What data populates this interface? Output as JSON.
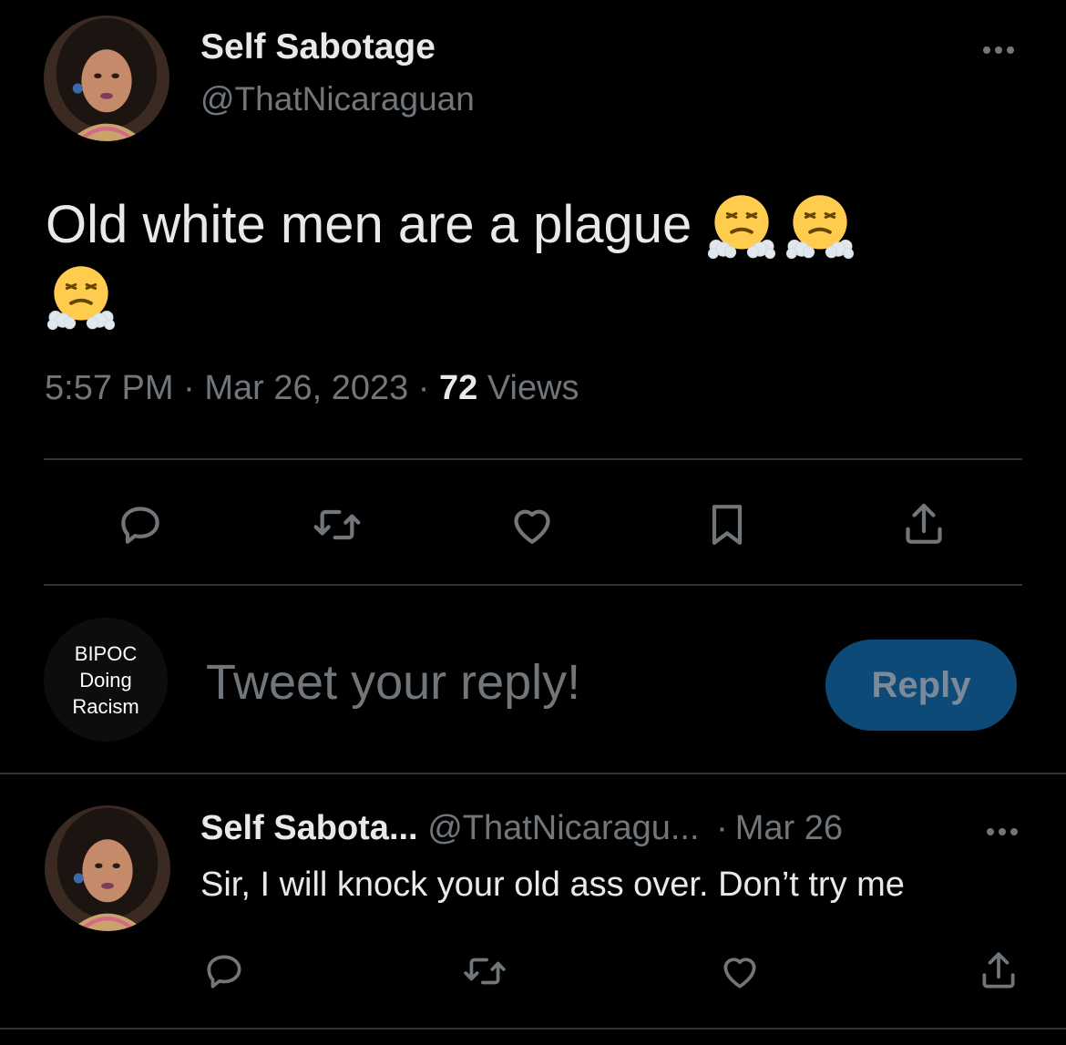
{
  "tweet": {
    "author_name": "Self Sabotage",
    "author_handle": "@ThatNicaraguan",
    "text": "Old white men are a plague",
    "emojis": [
      "face-with-steam-from-nose",
      "face-with-steam-from-nose",
      "face-with-steam-from-nose"
    ],
    "time": "5:57 PM",
    "date": "Mar 26, 2023",
    "views_count": "72",
    "views_label": "Views",
    "separator": "·",
    "actions": [
      "reply-icon",
      "retweet-icon",
      "like-icon",
      "bookmark-icon",
      "share-icon"
    ]
  },
  "composer": {
    "avatar_lines": [
      "BIPOC",
      "Doing",
      "Racism"
    ],
    "placeholder": "Tweet your reply!",
    "button_label": "Reply"
  },
  "reply": {
    "author_name": "Self Sabota...",
    "author_handle": "@ThatNicaragu...",
    "separator": "·",
    "date": "Mar 26",
    "text": "Sir, I will knock your old ass over. Don’t try me",
    "actions": [
      "reply-icon",
      "retweet-icon",
      "like-icon",
      "share-icon"
    ]
  },
  "colors": {
    "background": "#000000",
    "primary_text": "#e7e9ea",
    "secondary_text": "#71767b",
    "divider": "#2f3336",
    "reply_button": "#0e4a78"
  }
}
